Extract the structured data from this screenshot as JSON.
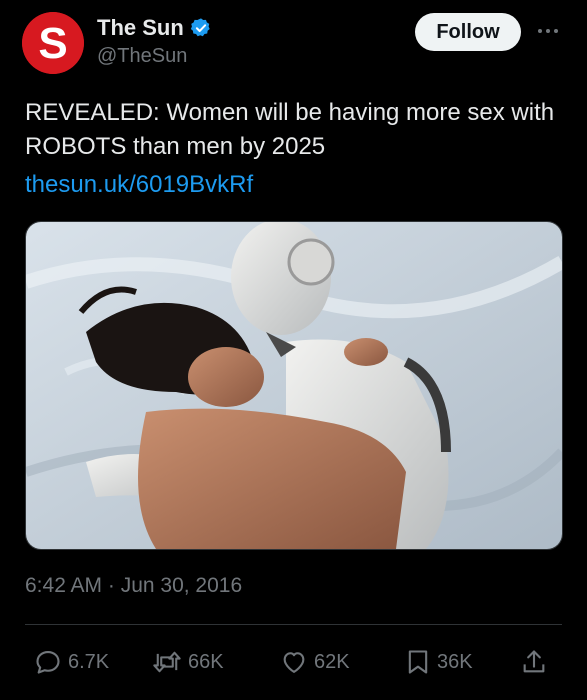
{
  "author": {
    "display_name": "The Sun",
    "handle": "@TheSun",
    "avatar_letter": "S",
    "verified": true
  },
  "follow_label": "Follow",
  "tweet": {
    "text": "REVEALED: Women will be having more sex with ROBOTS than men by 2025",
    "link": "thesun.uk/6019BvkRf",
    "timestamp": "6:42 AM · Jun 30, 2016"
  },
  "metrics": {
    "replies": "6.7K",
    "retweets": "66K",
    "likes": "62K",
    "bookmarks": "36K"
  },
  "colors": {
    "background": "#000000",
    "text": "#e7e9ea",
    "muted": "#71767b",
    "link": "#1d9bf0",
    "verified": "#1d9bf0",
    "brand_red": "#d71920"
  },
  "icons": [
    "sun-logo-icon",
    "verified-badge-icon",
    "more-icon",
    "reply-icon",
    "retweet-icon",
    "like-icon",
    "bookmark-icon",
    "share-icon"
  ]
}
